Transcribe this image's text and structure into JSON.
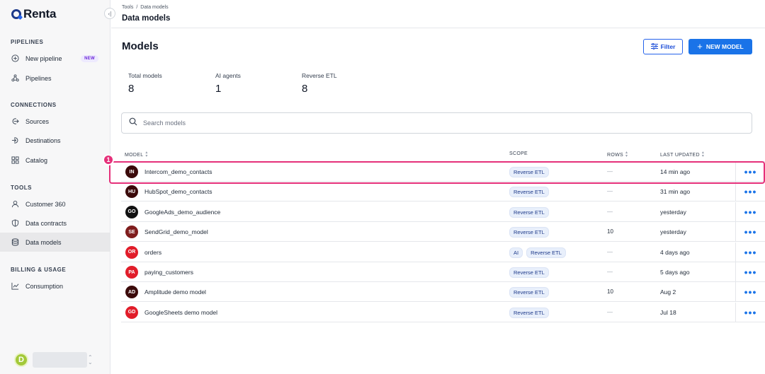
{
  "app": {
    "name": "Renta"
  },
  "sidebar": {
    "sections": [
      {
        "title": "PIPELINES",
        "items": [
          {
            "label": "New pipeline",
            "icon": "plus-circle-icon",
            "badge": "NEW"
          },
          {
            "label": "Pipelines",
            "icon": "pipelines-icon"
          }
        ]
      },
      {
        "title": "CONNECTIONS",
        "items": [
          {
            "label": "Sources",
            "icon": "source-icon"
          },
          {
            "label": "Destinations",
            "icon": "destination-icon"
          },
          {
            "label": "Catalog",
            "icon": "catalog-icon"
          }
        ]
      },
      {
        "title": "TOOLS",
        "items": [
          {
            "label": "Customer 360",
            "icon": "user-icon"
          },
          {
            "label": "Data contracts",
            "icon": "shield-icon"
          },
          {
            "label": "Data models",
            "icon": "database-icon",
            "active": true
          }
        ]
      },
      {
        "title": "BILLING & USAGE",
        "items": [
          {
            "label": "Consumption",
            "icon": "chart-icon"
          }
        ]
      }
    ],
    "user": {
      "initial": "D"
    }
  },
  "header": {
    "breadcrumb": [
      "Tools",
      "/",
      "Data models"
    ],
    "title": "Data models"
  },
  "main": {
    "title": "Models",
    "filter_label": "Filter",
    "new_model_label": "NEW MODEL",
    "stats": [
      {
        "label": "Total models",
        "value": "8"
      },
      {
        "label": "AI agents",
        "value": "1"
      },
      {
        "label": "Reverse ETL",
        "value": "8"
      }
    ],
    "search_placeholder": "Search models",
    "columns": {
      "model": "MODEL",
      "scope": "SCOPE",
      "rows": "ROWS",
      "last_updated": "LAST UPDATED"
    },
    "rows": [
      {
        "initials": "IN",
        "color": "#3b0a0a",
        "name": "Intercom_demo_contacts",
        "scope": [
          "Reverse ETL"
        ],
        "rows": "—",
        "updated": "14 min ago"
      },
      {
        "initials": "HU",
        "color": "#3b0a0a",
        "name": "HubSpot_demo_contacts",
        "scope": [
          "Reverse ETL"
        ],
        "rows": "—",
        "updated": "31 min ago"
      },
      {
        "initials": "GO",
        "color": "#111111",
        "name": "GoogleAds_demo_audience",
        "scope": [
          "Reverse ETL"
        ],
        "rows": "—",
        "updated": "yesterday"
      },
      {
        "initials": "SE",
        "color": "#7f1d1d",
        "name": "SendGrid_demo_model",
        "scope": [
          "Reverse ETL"
        ],
        "rows": "10",
        "updated": "yesterday"
      },
      {
        "initials": "OR",
        "color": "#e11d2a",
        "name": "orders",
        "scope": [
          "AI",
          "Reverse ETL"
        ],
        "rows": "—",
        "updated": "4 days ago"
      },
      {
        "initials": "PA",
        "color": "#e11d2a",
        "name": "paying_customers",
        "scope": [
          "Reverse ETL"
        ],
        "rows": "—",
        "updated": "5 days ago"
      },
      {
        "initials": "AD",
        "color": "#3b0a0a",
        "name": "Amplitude demo model",
        "scope": [
          "Reverse ETL"
        ],
        "rows": "10",
        "updated": "Aug 2"
      },
      {
        "initials": "GD",
        "color": "#e11d2a",
        "name": "GoogleSheets demo model",
        "scope": [
          "Reverse ETL"
        ],
        "rows": "—",
        "updated": "Jul 18"
      }
    ],
    "annotation": {
      "step": "1"
    }
  }
}
